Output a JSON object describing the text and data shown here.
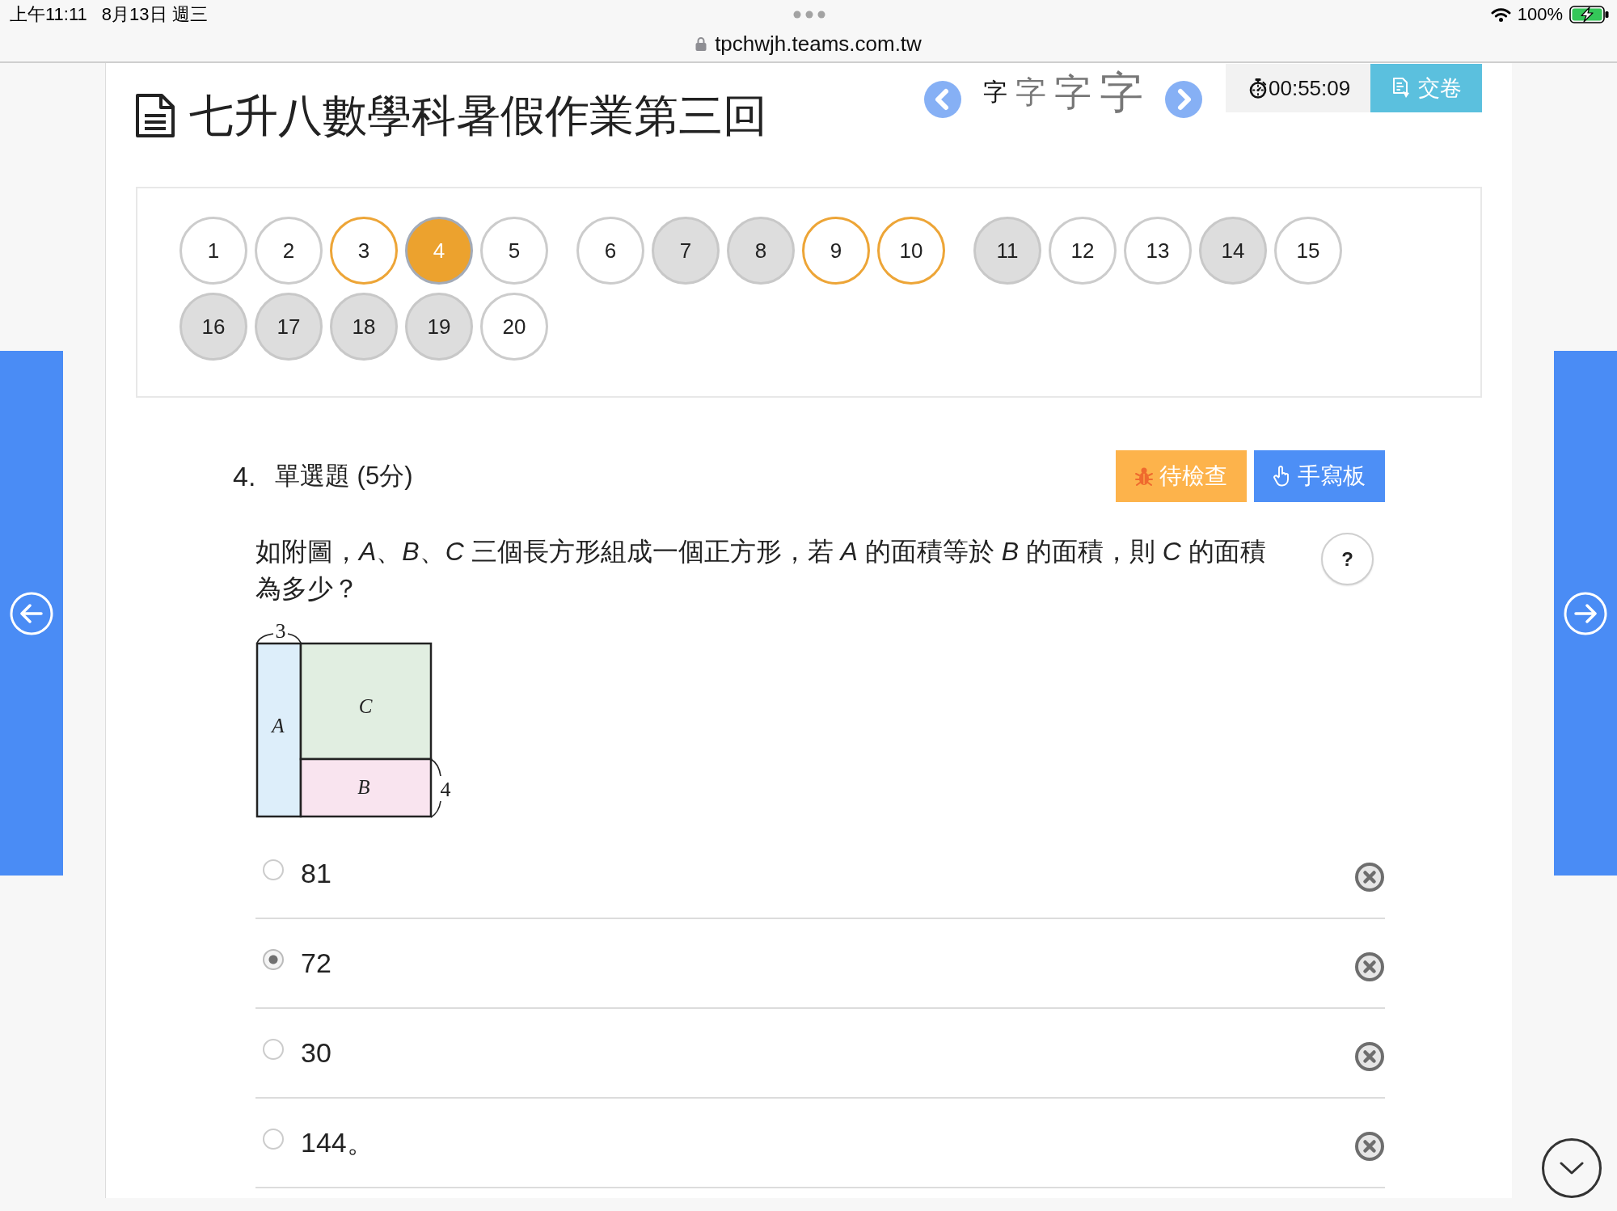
{
  "status_bar": {
    "time": "上午11:11",
    "date": "8月13日 週三",
    "url": "tpchwjh.teams.com.tw",
    "battery": "100%"
  },
  "header": {
    "title": "七升八數學科暑假作業第三回",
    "font_sizes": [
      {
        "label": "字",
        "selected": true
      },
      {
        "label": "字",
        "selected": false
      },
      {
        "label": "字",
        "selected": false
      },
      {
        "label": "字",
        "selected": false
      }
    ],
    "timer": "00:55:09",
    "submit": "交卷"
  },
  "question_nav": [
    {
      "label": "1",
      "answered": false,
      "flagged": false,
      "selected": false
    },
    {
      "label": "2",
      "answered": false,
      "flagged": false,
      "selected": false
    },
    {
      "label": "3",
      "answered": false,
      "flagged": true,
      "selected": false
    },
    {
      "label": "4",
      "answered": true,
      "flagged": false,
      "selected": true
    },
    {
      "label": "5",
      "answered": false,
      "flagged": false,
      "selected": false
    },
    {
      "label": "6",
      "answered": false,
      "flagged": false,
      "selected": false
    },
    {
      "label": "7",
      "answered": true,
      "flagged": false,
      "selected": false
    },
    {
      "label": "8",
      "answered": true,
      "flagged": false,
      "selected": false
    },
    {
      "label": "9",
      "answered": false,
      "flagged": true,
      "selected": false
    },
    {
      "label": "10",
      "answered": false,
      "flagged": true,
      "selected": false
    },
    {
      "label": "11",
      "answered": true,
      "flagged": false,
      "selected": false
    },
    {
      "label": "12",
      "answered": false,
      "flagged": false,
      "selected": false
    },
    {
      "label": "13",
      "answered": false,
      "flagged": false,
      "selected": false
    },
    {
      "label": "14",
      "answered": true,
      "flagged": false,
      "selected": false
    },
    {
      "label": "15",
      "answered": false,
      "flagged": false,
      "selected": false
    },
    {
      "label": "16",
      "answered": true,
      "flagged": false,
      "selected": false
    },
    {
      "label": "17",
      "answered": true,
      "flagged": false,
      "selected": false
    },
    {
      "label": "18",
      "answered": true,
      "flagged": false,
      "selected": false
    },
    {
      "label": "19",
      "answered": true,
      "flagged": false,
      "selected": false
    },
    {
      "label": "20",
      "answered": false,
      "flagged": false,
      "selected": false
    }
  ],
  "question": {
    "number": "4.",
    "type": "單選題 (5分)",
    "buttons": [
      {
        "label": "待檢查",
        "kind": "review"
      },
      {
        "label": "手寫板",
        "kind": "handwriting"
      }
    ],
    "text": "如附圖，*A*、*B*、*C* 三個長方形組成一個正方形，若 *A* 的面積等於 *B* 的面積，則 *C* 的面積為多少？",
    "help": "?",
    "figure": {
      "rectangles": [
        {
          "label": "A",
          "color": "#ddeefa"
        },
        {
          "label": "C",
          "color": "#e1eee1"
        },
        {
          "label": "B",
          "color": "#f9e4ef"
        }
      ],
      "top_dimension": "3",
      "side_dimension": "4"
    },
    "options": [
      {
        "text": "81",
        "selected": false
      },
      {
        "text": "72",
        "selected": true
      },
      {
        "text": "30",
        "selected": false
      },
      {
        "text": "144。",
        "selected": false
      }
    ]
  }
}
